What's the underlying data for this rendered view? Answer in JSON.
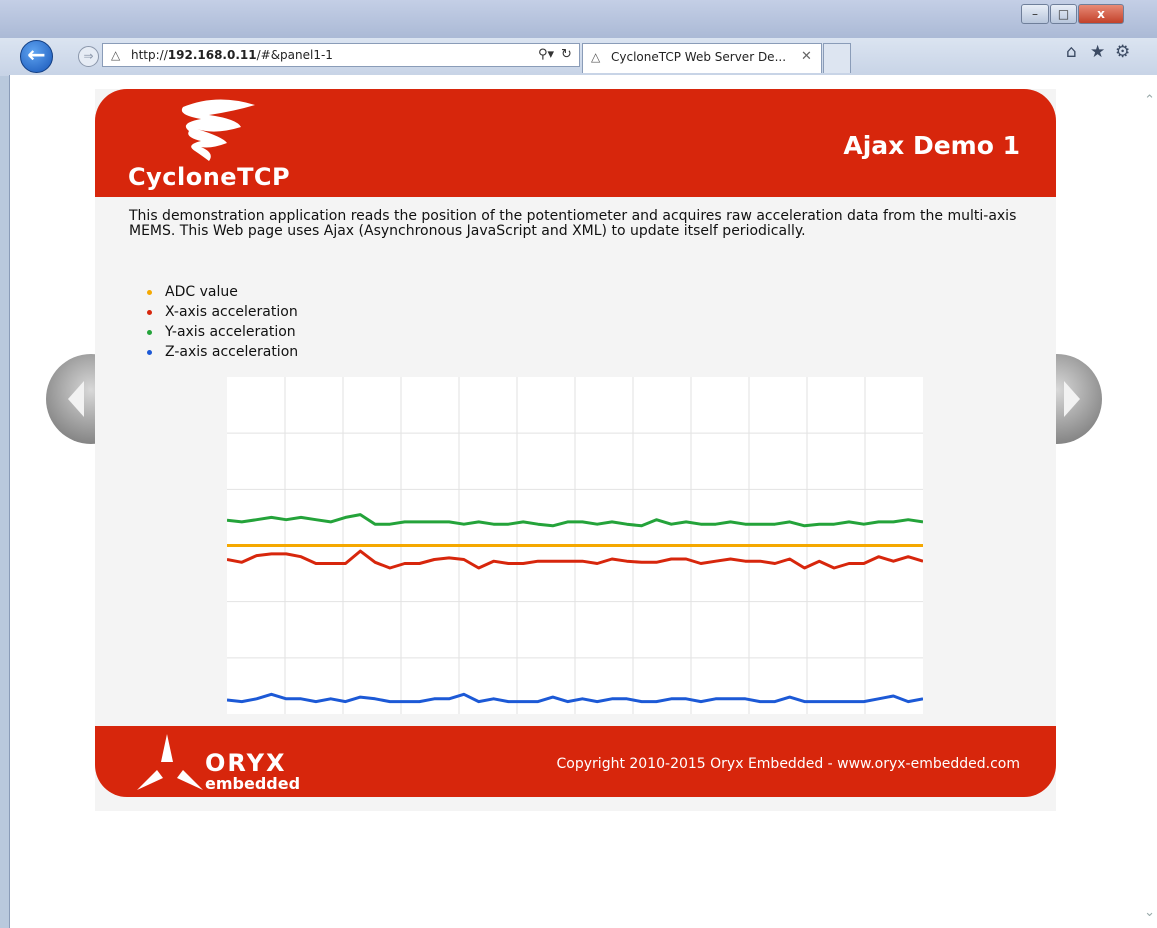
{
  "browser": {
    "url_prefix": "http://",
    "url_host": "192.168.0.11",
    "url_path": "/#&panel1-1",
    "tab_title": "CycloneTCP Web Server De...",
    "window_buttons": {
      "minimize": "–",
      "maximize": "□",
      "close": "x"
    },
    "icons": {
      "back": "back-arrow-icon",
      "forward": "forward-arrow-icon",
      "search": "search-icon",
      "refresh": "refresh-icon",
      "home": "home-icon",
      "favorites": "star-icon",
      "settings": "gear-icon"
    }
  },
  "header": {
    "logo_text": "CycloneTCP",
    "title": "Ajax Demo 1"
  },
  "description": "This demonstration application reads the position of the potentiometer and acquires raw acceleration data from the multi-axis MEMS. This Web page uses Ajax (Asynchronous JavaScript and XML) to update itself periodically.",
  "legend": [
    {
      "label": "ADC value",
      "color": "#f5a800"
    },
    {
      "label": "X-axis acceleration",
      "color": "#d7260c"
    },
    {
      "label": "Y-axis acceleration",
      "color": "#24a33a"
    },
    {
      "label": "Z-axis acceleration",
      "color": "#1c59d6"
    }
  ],
  "chart_data": {
    "type": "line",
    "grid": true,
    "ylim": [
      0,
      6
    ],
    "series": [
      {
        "name": "ADC value",
        "color": "#f5a800",
        "values": [
          3.0,
          3.0,
          3.0,
          3.0,
          3.0,
          3.0,
          3.0,
          3.0,
          3.0,
          3.0,
          3.0,
          3.0,
          3.0,
          3.0,
          3.0,
          3.0,
          3.0,
          3.0,
          3.0,
          3.0,
          3.0,
          3.0,
          3.0,
          3.0,
          3.0,
          3.0,
          3.0,
          3.0,
          3.0,
          3.0,
          3.0,
          3.0,
          3.0,
          3.0,
          3.0,
          3.0,
          3.0,
          3.0,
          3.0,
          3.0,
          3.0,
          3.0,
          3.0,
          3.0,
          3.0,
          3.0,
          3.0,
          3.0
        ]
      },
      {
        "name": "X-axis acceleration",
        "color": "#d7260c",
        "values": [
          2.75,
          2.7,
          2.82,
          2.85,
          2.85,
          2.8,
          2.68,
          2.68,
          2.68,
          2.9,
          2.7,
          2.6,
          2.68,
          2.68,
          2.75,
          2.78,
          2.75,
          2.6,
          2.72,
          2.68,
          2.68,
          2.72,
          2.72,
          2.72,
          2.72,
          2.68,
          2.76,
          2.72,
          2.7,
          2.7,
          2.76,
          2.76,
          2.68,
          2.72,
          2.76,
          2.72,
          2.72,
          2.68,
          2.76,
          2.6,
          2.72,
          2.6,
          2.68,
          2.68,
          2.8,
          2.72,
          2.8,
          2.72
        ]
      },
      {
        "name": "Y-axis acceleration",
        "color": "#24a33a",
        "values": [
          3.45,
          3.42,
          3.46,
          3.5,
          3.46,
          3.5,
          3.46,
          3.42,
          3.5,
          3.55,
          3.38,
          3.38,
          3.42,
          3.42,
          3.42,
          3.42,
          3.38,
          3.42,
          3.38,
          3.38,
          3.42,
          3.38,
          3.35,
          3.42,
          3.42,
          3.38,
          3.42,
          3.38,
          3.35,
          3.46,
          3.38,
          3.42,
          3.38,
          3.38,
          3.42,
          3.38,
          3.38,
          3.38,
          3.42,
          3.35,
          3.38,
          3.38,
          3.42,
          3.38,
          3.42,
          3.42,
          3.46,
          3.42
        ]
      },
      {
        "name": "Z-axis acceleration",
        "color": "#1c59d6",
        "values": [
          0.25,
          0.22,
          0.27,
          0.35,
          0.27,
          0.27,
          0.22,
          0.27,
          0.22,
          0.3,
          0.27,
          0.22,
          0.22,
          0.22,
          0.27,
          0.27,
          0.35,
          0.22,
          0.27,
          0.22,
          0.22,
          0.22,
          0.3,
          0.22,
          0.27,
          0.22,
          0.27,
          0.27,
          0.22,
          0.22,
          0.27,
          0.27,
          0.22,
          0.27,
          0.27,
          0.27,
          0.22,
          0.22,
          0.3,
          0.22,
          0.22,
          0.22,
          0.22,
          0.22,
          0.27,
          0.32,
          0.22,
          0.27
        ]
      }
    ]
  },
  "footer": {
    "logo_text": "ORYX",
    "logo_subtext": "embedded",
    "copyright": "Copyright 2010-2015 Oryx Embedded - www.oryx-embedded.com"
  }
}
